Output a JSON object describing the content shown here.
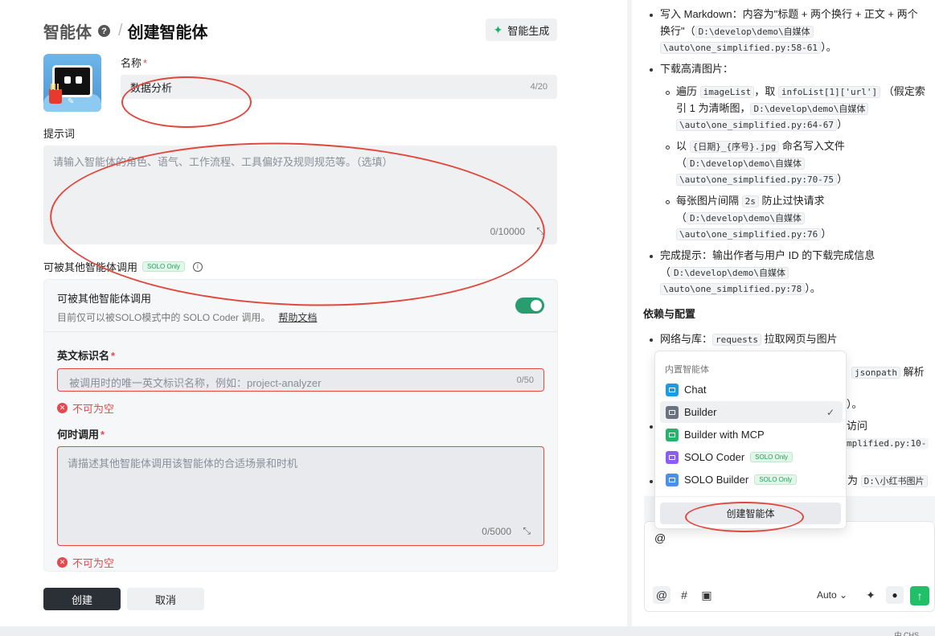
{
  "form": {
    "breadcrumb_root": "智能体",
    "breadcrumb_sep": "/",
    "page_title": "创建智能体",
    "generate_button": "智能生成",
    "name_label": "名称",
    "name_value": "数据分析",
    "name_counter": "4/20",
    "prompt_label": "提示词",
    "prompt_placeholder": "请输入智能体的角色、语气、工作流程、工具偏好及规则规范等。（选填）",
    "prompt_counter": "0/10000",
    "callable_label": "可被其他智能体调用",
    "solo_tag": "SOLO Only",
    "card": {
      "title": "可被其他智能体调用",
      "desc": "目前仅可以被SOLO模式中的 SOLO Coder 调用。",
      "help_link": "帮助文档",
      "toggle_on": true
    },
    "id_label": "英文标识名",
    "id_placeholder": "被调用时的唯一英文标识名称，例如：project-analyzer",
    "id_counter": "0/50",
    "id_error": "不可为空",
    "when_label": "何时调用",
    "when_placeholder": "请描述其他智能体调用该智能体的合适场景和时机",
    "when_counter": "0/5000",
    "when_error": "不可为空",
    "create_button": "创建",
    "cancel_button": "取消"
  },
  "chat": {
    "line1": "写入 Markdown：内容为\"标题 + 两个换行 + 正文 + 两个",
    "line2": "换行\"（",
    "code_md_a": "D:\\develop\\demo\\自媒体",
    "code_md_b": "\\auto\\one_simplified.py:58-61",
    "line2_end": "）。",
    "download_title": "下载高清图片：",
    "sub1_a": "遍历",
    "sub1_code1": "imageList",
    "sub1_b": "，取",
    "sub1_code2": "infoList[1]['url']",
    "sub1_c": "（假定索",
    "sub1_line2": "引 1 为清晰图，",
    "code_6467_a": "D:\\develop\\demo\\自媒体",
    "code_6467_b": "\\auto\\one_simplified.py:64-67",
    "sub2_a": "以",
    "sub2_code": "{日期}_{序号}.jpg",
    "sub2_b": "命名写入文件",
    "code_7075_a": "D:\\develop\\demo\\自媒体",
    "code_7075_b": "\\auto\\one_simplified.py:70-75",
    "sub3_a": "每张图片间隔",
    "sub3_code": "2s",
    "sub3_b": "防止过快请求",
    "code_76_a": "D:\\develop\\demo\\自媒体",
    "code_76_b": "\\auto\\one_simplified.py:76",
    "done_line": "完成提示：输出作者与用户 ID 的下载完成信息",
    "code_78_a": "D:\\develop\\demo\\自媒体",
    "code_78_b": "\\auto\\one_simplified.py:78",
    "paren_close": "）",
    "paren_close_dot": "）。",
    "paren_open": "（",
    "section_title": "依赖与配置",
    "dep1_a": "网络与库：",
    "dep1_code": "requests",
    "dep1_b": "拉取网页与图片",
    "frag_jsonpath": "jsonpath",
    "frag_parse": "解析",
    "frag_dot": "）。",
    "frag_visit": "访问",
    "frag_code_line": "mplified.py:10-",
    "frag_as": "为",
    "frag_code_dir": "D:\\小红书图片",
    "typed_text": "@",
    "model_select": "Auto"
  },
  "dropdown": {
    "group_label": "内置智能体",
    "options": [
      {
        "label": "Chat",
        "color": "#1a9de0",
        "selected": false,
        "solo": false
      },
      {
        "label": "Builder",
        "color": "#6b7280",
        "selected": true,
        "solo": false
      },
      {
        "label": "Builder with MCP",
        "color": "#21b46b",
        "selected": false,
        "solo": false
      },
      {
        "label": "SOLO Coder",
        "color": "#8b5cf6",
        "selected": false,
        "solo": true
      },
      {
        "label": "SOLO Builder",
        "color": "#4a8fe8",
        "selected": false,
        "solo": true
      }
    ],
    "solo_tag": "SOLO Only",
    "create_button": "创建智能体"
  },
  "status_bar": {
    "text": "中 CHS"
  },
  "colors": {
    "accent_green": "#2a9d70",
    "error_red": "#e5484d",
    "annotation_red": "#e0483d",
    "send_green": "#20c069"
  }
}
